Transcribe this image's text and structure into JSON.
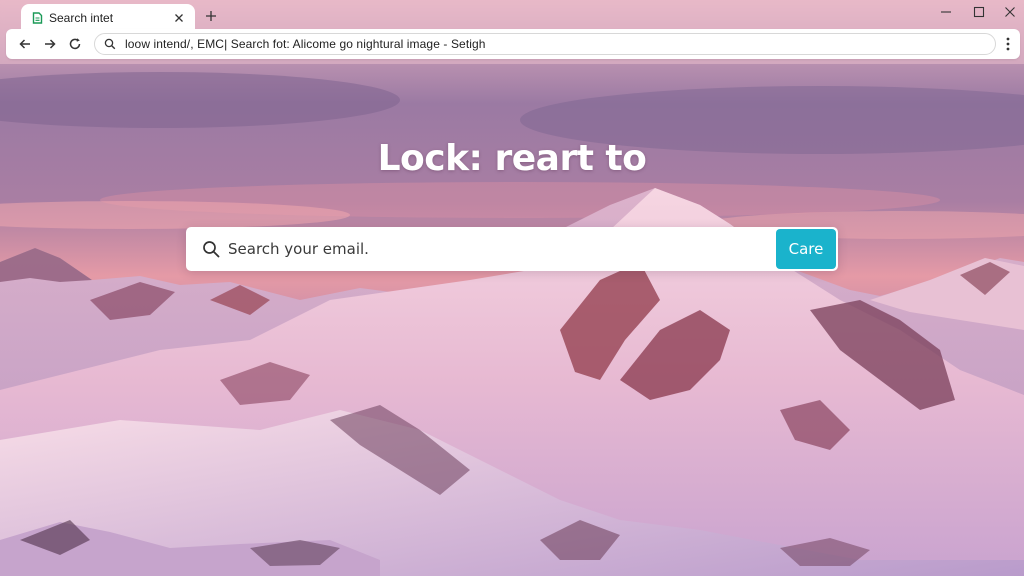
{
  "browser": {
    "tab": {
      "title": "Search intet"
    },
    "address_bar": {
      "url": "loow intend/, EMC| Search fot: Alicome go nightural image - Setigh"
    },
    "icons": {
      "favicon": "page-icon",
      "tab_close": "close-icon",
      "new_tab": "plus-icon",
      "minimize": "minimize-icon",
      "maximize": "maximize-icon",
      "window_close": "close-icon",
      "back": "arrow-left-icon",
      "forward": "arrow-right-icon",
      "reload": "reload-icon",
      "address_search": "search-icon",
      "menu": "kebab-menu-icon"
    }
  },
  "page": {
    "headline": "Lock: reart to",
    "search": {
      "placeholder": "Search your email.",
      "button_label": "Care"
    }
  },
  "colors": {
    "accent": "#1ab3cc",
    "sky_top": "#8f6f98",
    "sky_glow": "#e39aa3",
    "snow": "#f3d2e0",
    "rock": "#9b4a5a"
  }
}
